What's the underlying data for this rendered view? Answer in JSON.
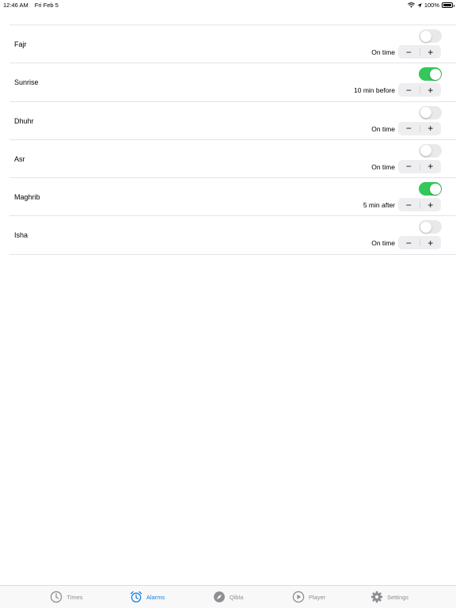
{
  "status_bar": {
    "time": "12:46 AM",
    "date": "Fri Feb 5",
    "battery": "100%"
  },
  "alarms": [
    {
      "name": "Fajr",
      "enabled": false,
      "offset": "On time"
    },
    {
      "name": "Sunrise",
      "enabled": true,
      "offset": "10 min  before"
    },
    {
      "name": "Dhuhr",
      "enabled": false,
      "offset": "On time"
    },
    {
      "name": "Asr",
      "enabled": false,
      "offset": "On time"
    },
    {
      "name": "Maghrib",
      "enabled": true,
      "offset": "5 min  after"
    },
    {
      "name": "Isha",
      "enabled": false,
      "offset": "On time"
    }
  ],
  "stepper": {
    "minus": "−",
    "plus": "+"
  },
  "tabs": [
    {
      "label": "Times",
      "icon": "clock-icon",
      "active": false
    },
    {
      "label": "Alarms",
      "icon": "alarm-clock-icon",
      "active": true
    },
    {
      "label": "Qibla",
      "icon": "compass-icon",
      "active": false
    },
    {
      "label": "Player",
      "icon": "play-circle-icon",
      "active": false
    },
    {
      "label": "Settings",
      "icon": "gear-icon",
      "active": false
    }
  ],
  "colors": {
    "toggle_on": "#34c759",
    "toggle_off": "#e9e9eb",
    "accent": "#1a7ee6",
    "inactive_tab": "#8e8e93"
  }
}
